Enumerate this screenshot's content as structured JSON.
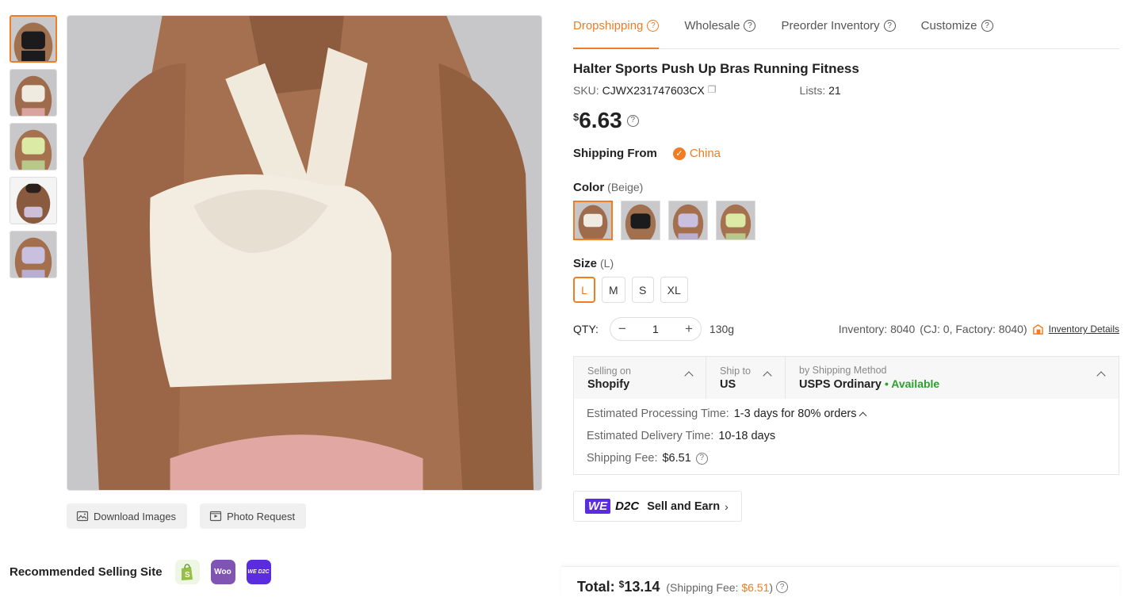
{
  "gallery": {
    "thumbnails": [
      "black",
      "beige",
      "green",
      "black-back",
      "purple"
    ],
    "download_label": "Download Images",
    "photo_request_label": "Photo Request"
  },
  "recommended": {
    "label": "Recommended Selling Site",
    "sites": [
      "shopify-icon",
      "woo-icon",
      "we-d2c-icon"
    ],
    "woo_text": "Woo",
    "wed2c_text": "WE D2C"
  },
  "tabs": [
    {
      "label": "Dropshipping",
      "active": true
    },
    {
      "label": "Wholesale"
    },
    {
      "label": "Preorder Inventory"
    },
    {
      "label": "Customize"
    }
  ],
  "product": {
    "title": "Halter Sports Push Up Bras Running Fitness",
    "sku_label": "SKU:",
    "sku": "CJWX231747603CX",
    "lists_label": "Lists:",
    "lists": "21",
    "currency": "$",
    "price": "6.63"
  },
  "shipping_from": {
    "label": "Shipping From",
    "value": "China"
  },
  "color": {
    "label": "Color",
    "selected": "(Beige)",
    "options": [
      "Beige",
      "Black",
      "Purple",
      "Green"
    ]
  },
  "size": {
    "label": "Size",
    "selected": "(L)",
    "options": [
      "L",
      "M",
      "S",
      "XL"
    ]
  },
  "qty": {
    "label": "QTY:",
    "value": "1",
    "minus": "−",
    "plus": "+",
    "weight": "130g"
  },
  "inventory": {
    "text": "Inventory: 8040",
    "detail": "(CJ: 0, Factory: 8040)",
    "link": "Inventory Details"
  },
  "ship": {
    "selling_on_label": "Selling on",
    "selling_on": "Shopify",
    "ship_to_label": "Ship to",
    "ship_to": "US",
    "method_label": "by Shipping Method",
    "method": "USPS Ordinary",
    "available": "• Available",
    "processing_label": "Estimated Processing Time:",
    "processing": "1-3 days for 80% orders",
    "delivery_label": "Estimated Delivery Time:",
    "delivery": "10-18 days",
    "fee_label": "Shipping Fee:",
    "fee": "$6.51"
  },
  "wed2c": {
    "we": "WE",
    "d2c": "D2C",
    "label": "Sell and Earn"
  },
  "total": {
    "label": "Total:",
    "currency": "$",
    "value": "13.14",
    "fee_prefix": "(Shipping Fee:",
    "fee": "$6.51",
    "fee_suffix": ")"
  },
  "colors": {
    "accent": "#f17c21",
    "available": "#2e9e2e",
    "we_purple": "#5b2be0"
  }
}
